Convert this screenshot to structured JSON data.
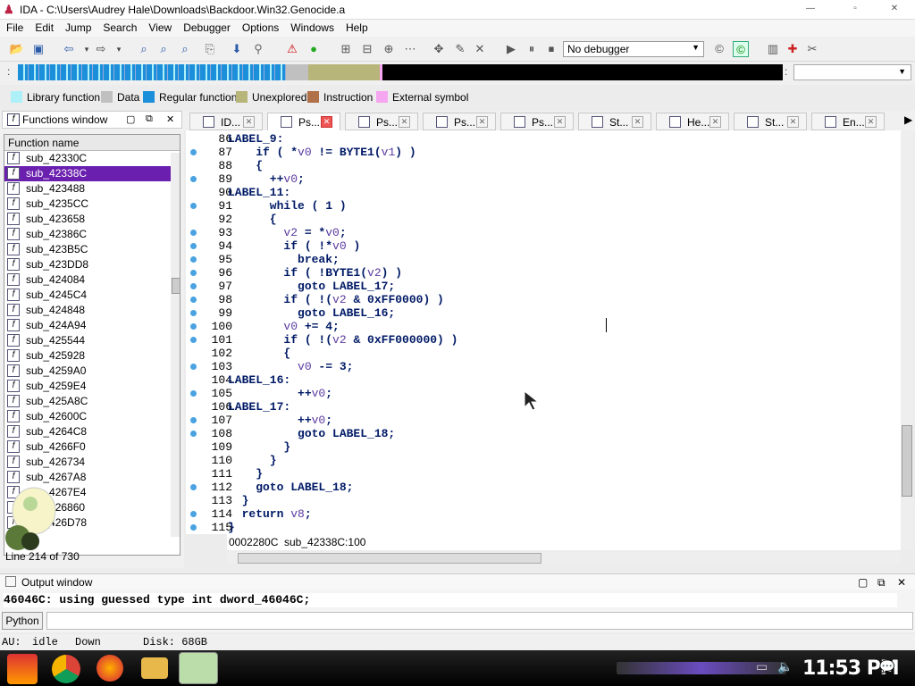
{
  "window": {
    "title": "IDA - C:\\Users\\Audrey Hale\\Downloads\\Backdoor.Win32.Genocide.a"
  },
  "menu": [
    "File",
    "Edit",
    "Jump",
    "Search",
    "View",
    "Debugger",
    "Options",
    "Windows",
    "Help"
  ],
  "toolbar": {
    "debugger": "No debugger"
  },
  "legend": [
    {
      "label": "Library function",
      "color": "#aef0f8"
    },
    {
      "label": "Data",
      "color": "#c0c0c0"
    },
    {
      "label": "Regular function",
      "color": "#1b8fd9"
    },
    {
      "label": "Unexplored",
      "color": "#b8b57a"
    },
    {
      "label": "Instruction",
      "color": "#b07048"
    },
    {
      "label": "External symbol",
      "color": "#f6a6f0"
    }
  ],
  "functions": {
    "title": "Functions window",
    "column": "Function name",
    "selected": "sub_42338C",
    "items": [
      "sub_42330C",
      "sub_42338C",
      "sub_423488",
      "sub_4235CC",
      "sub_423658",
      "sub_42386C",
      "sub_423B5C",
      "sub_423DD8",
      "sub_424084",
      "sub_4245C4",
      "sub_424848",
      "sub_424A94",
      "sub_425544",
      "sub_425928",
      "sub_4259A0",
      "sub_4259E4",
      "sub_425A8C",
      "sub_42600C",
      "sub_4264C8",
      "sub_4266F0",
      "sub_426734",
      "sub_4267A8",
      "sub_4267E4",
      "sub_426860",
      "sub_426D78"
    ],
    "line_status": "Line 214 of 730"
  },
  "tabs": [
    "ID...",
    "Ps...",
    "Ps...",
    "Ps...",
    "Ps...",
    "St...",
    "He...",
    "St...",
    "En..."
  ],
  "active_tab": 1,
  "code": [
    {
      "n": "86",
      "dot": false,
      "t": "LABEL_9:"
    },
    {
      "n": "87",
      "dot": true,
      "t": "    if ( *v0 != BYTE1(v1) )"
    },
    {
      "n": "88",
      "dot": false,
      "t": "    {"
    },
    {
      "n": "89",
      "dot": true,
      "t": "      ++v0;"
    },
    {
      "n": "90",
      "dot": false,
      "t": "LABEL_11:"
    },
    {
      "n": "91",
      "dot": true,
      "t": "      while ( 1 )"
    },
    {
      "n": "92",
      "dot": false,
      "t": "      {"
    },
    {
      "n": "93",
      "dot": true,
      "t": "        v2 = *v0;"
    },
    {
      "n": "94",
      "dot": true,
      "t": "        if ( !*v0 )"
    },
    {
      "n": "95",
      "dot": true,
      "t": "          break;"
    },
    {
      "n": "96",
      "dot": true,
      "t": "        if ( !BYTE1(v2) )"
    },
    {
      "n": "97",
      "dot": true,
      "t": "          goto LABEL_17;"
    },
    {
      "n": "98",
      "dot": true,
      "t": "        if ( !(v2 & 0xFF0000) )"
    },
    {
      "n": "99",
      "dot": true,
      "t": "          goto LABEL_16;"
    },
    {
      "n": "100",
      "dot": true,
      "t": "        v0 += 4;"
    },
    {
      "n": "101",
      "dot": true,
      "t": "        if ( !(v2 & 0xFF000000) )"
    },
    {
      "n": "102",
      "dot": false,
      "t": "        {"
    },
    {
      "n": "103",
      "dot": true,
      "t": "          v0 -= 3;"
    },
    {
      "n": "104",
      "dot": false,
      "t": "LABEL_16:"
    },
    {
      "n": "105",
      "dot": true,
      "t": "          ++v0;"
    },
    {
      "n": "106",
      "dot": false,
      "t": "LABEL_17:"
    },
    {
      "n": "107",
      "dot": true,
      "t": "          ++v0;"
    },
    {
      "n": "108",
      "dot": true,
      "t": "          goto LABEL_18;"
    },
    {
      "n": "109",
      "dot": false,
      "t": "        }"
    },
    {
      "n": "110",
      "dot": false,
      "t": "      }"
    },
    {
      "n": "111",
      "dot": false,
      "t": "    }"
    },
    {
      "n": "112",
      "dot": true,
      "t": "    goto LABEL_18;"
    },
    {
      "n": "113",
      "dot": false,
      "t": "  }"
    },
    {
      "n": "114",
      "dot": true,
      "t": "  return v8;"
    },
    {
      "n": "115",
      "dot": true,
      "t": "}"
    }
  ],
  "address": {
    "offset": "0002280C",
    "location": "sub_42338C:100"
  },
  "output": {
    "title": "Output window",
    "text": "46046C: using guessed type int dword_46046C;",
    "python": "Python"
  },
  "status": {
    "au": "AU:",
    "state": "idle",
    "dir": "Down",
    "disk": "Disk: 68GB"
  },
  "clock": "11:53 PM"
}
